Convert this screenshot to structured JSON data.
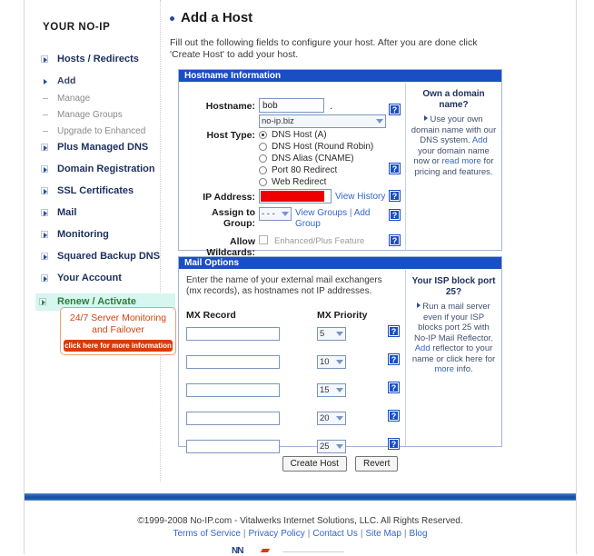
{
  "sidebar": {
    "title": "YOUR NO-IP",
    "items": [
      {
        "label": "Hosts / Redirects",
        "type": "top"
      },
      {
        "label": "Add",
        "type": "sub-bullet"
      },
      {
        "label": "Manage",
        "type": "sub-dash"
      },
      {
        "label": "Manage Groups",
        "type": "sub-dash"
      },
      {
        "label": "Upgrade to Enhanced",
        "type": "sub-dash"
      },
      {
        "label": "Plus Managed DNS",
        "type": "top"
      },
      {
        "label": "Domain Registration",
        "type": "top"
      },
      {
        "label": "SSL Certificates",
        "type": "top"
      },
      {
        "label": "Mail",
        "type": "top"
      },
      {
        "label": "Monitoring",
        "type": "top"
      },
      {
        "label": "Squared Backup DNS",
        "type": "top"
      },
      {
        "label": "Your Account",
        "type": "top"
      },
      {
        "label": "Renew / Activate",
        "type": "top",
        "highlight": true
      }
    ],
    "promo": {
      "line1": "24/7 Server Monitoring",
      "line2": "and Failover",
      "cta": "click here for more information"
    }
  },
  "main": {
    "title": "Add a Host",
    "intro": "Fill out the following fields to configure your host. After you are done click 'Create Host' to add your host.",
    "hostname_panel": {
      "header": "Hostname Information",
      "hostname_label": "Hostname:",
      "hostname_value": "bob",
      "hostname_dot": ".",
      "domain_selected": "no-ip.biz",
      "host_type_label": "Host Type:",
      "host_types": [
        {
          "label": "DNS Host (A)",
          "selected": true
        },
        {
          "label": "DNS Host (Round Robin)",
          "selected": false
        },
        {
          "label": "DNS Alias (CNAME)",
          "selected": false
        },
        {
          "label": "Port 80 Redirect",
          "selected": false
        },
        {
          "label": "Web Redirect",
          "selected": false
        }
      ],
      "ip_label": "IP Address:",
      "ip_value": "",
      "view_history": "View History",
      "assign_label_l1": "Assign to",
      "assign_label_l2": "Group:",
      "group_selected": "- - -",
      "view_groups": "View Groups",
      "group_sep": "|",
      "add_group_1": "Add",
      "add_group_2": "Group",
      "wildcards_label": "Allow Wildcards:",
      "wildcards_note": "Enhanced/Plus Feature",
      "wildcards_checked": false,
      "help_symbol": "?"
    },
    "hostname_aside": {
      "title": "Own a domain name?",
      "text_1": "Use your own domain name with our DNS system.",
      "link_add": "Add",
      "text_2": "your domain name now or",
      "link_read_more": "read more",
      "text_3": "for pricing and features."
    },
    "mail_panel": {
      "header": "Mail Options",
      "description": "Enter the name of your external mail exchangers (mx records), as hostnames not IP addresses.",
      "mx_record_header": "MX Record",
      "mx_priority_header": "MX Priority",
      "rows": [
        {
          "record": "",
          "priority": "5"
        },
        {
          "record": "",
          "priority": "10"
        },
        {
          "record": "",
          "priority": "15"
        },
        {
          "record": "",
          "priority": "20"
        },
        {
          "record": "",
          "priority": "25"
        }
      ]
    },
    "mail_aside": {
      "title_l1": "Your ISP block port",
      "title_l2": "25?",
      "text_1": "Run a mail server even if your ISP blocks port 25 with No-IP Mail Reflector.",
      "link_add": "Add",
      "text_2": "reflector to your name or click here for",
      "link_more": "more",
      "text_3": "info."
    },
    "buttons": {
      "create_host": "Create Host",
      "revert": "Revert"
    }
  },
  "footer": {
    "copyright": "©1999-2008 No-IP.com - Vitalwerks Internet Solutions, LLC. All Rights Reserved.",
    "links": [
      "Terms of Service",
      "Privacy Policy",
      "Contact Us",
      "Site Map",
      "Blog"
    ],
    "separator": "|",
    "logo_text": "NN"
  },
  "colors": {
    "panel_header": "#1a4ec4",
    "link": "#3366cc",
    "highlight_bg": "#d7f6ef",
    "highlight_text": "#2f7a3f",
    "promo_border": "#e8a074",
    "promo_cta": "#d93a0c",
    "redaction": "#ee0000"
  }
}
